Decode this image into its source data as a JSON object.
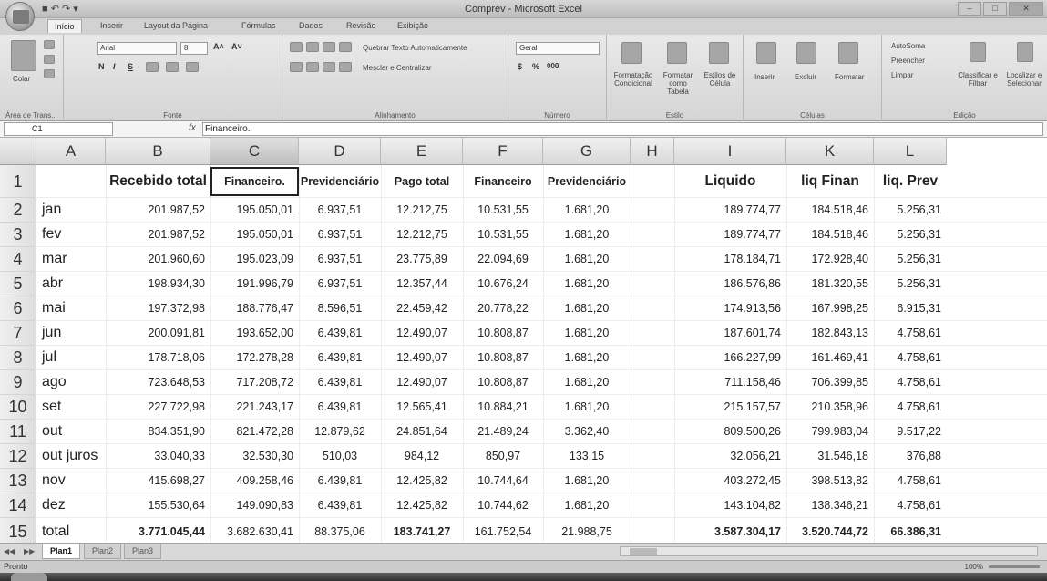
{
  "window": {
    "title": "Comprev - Microsoft Excel",
    "quick_access": "■ ↶ ↷ ▾",
    "minimize": "–",
    "maximize": "□",
    "close": "✕"
  },
  "ribbon_tabs": [
    "Início",
    "Inserir",
    "Layout da Página",
    "Fórmulas",
    "Dados",
    "Revisão",
    "Exibição"
  ],
  "ribbon": {
    "clipboard": {
      "paste": "Colar",
      "group": "Área de Trans..."
    },
    "font": {
      "name": "Arial",
      "size": "8",
      "grow": "A˄",
      "shrink": "A˅",
      "bold": "N",
      "italic": "I",
      "underline": "S",
      "group": "Fonte"
    },
    "alignment": {
      "wrap": "Quebrar Texto Automaticamente",
      "merge": "Mesclar e Centralizar",
      "group": "Alinhamento"
    },
    "number": {
      "format": "Geral",
      "currency": "$",
      "percent": "%",
      "thousands": "000",
      "group": "Número"
    },
    "styles": {
      "conditional": "Formatação Condicional",
      "as_table": "Formatar como Tabela",
      "cell_styles": "Estilos de Célula",
      "group": "Estilo"
    },
    "cells": {
      "insert": "Inserir",
      "delete": "Excluir",
      "format": "Formatar",
      "group": "Células"
    },
    "editing": {
      "autosum": "AutoSoma",
      "fill": "Preencher",
      "clear": "Limpar",
      "sort": "Classificar e Filtrar",
      "find": "Localizar e Selecionar",
      "group": "Edição"
    }
  },
  "formula_bar": {
    "name_box": "C1",
    "fx": "fx",
    "content": "Financeiro."
  },
  "columns": [
    "A",
    "B",
    "C",
    "D",
    "E",
    "F",
    "G",
    "H",
    "I",
    "K",
    "L"
  ],
  "headers": [
    "",
    "Recebido total",
    "Financeiro.",
    "Previdenciário",
    "Pago total",
    "Financeiro",
    "Previdenciário",
    "",
    "Liquido",
    "liq Finan",
    "liq. Prev"
  ],
  "rows": [
    [
      "jan",
      "201.987,52",
      "195.050,01",
      "6.937,51",
      "12.212,75",
      "10.531,55",
      "1.681,20",
      "",
      "189.774,77",
      "184.518,46",
      "5.256,31"
    ],
    [
      "fev",
      "201.987,52",
      "195.050,01",
      "6.937,51",
      "12.212,75",
      "10.531,55",
      "1.681,20",
      "",
      "189.774,77",
      "184.518,46",
      "5.256,31"
    ],
    [
      "mar",
      "201.960,60",
      "195.023,09",
      "6.937,51",
      "23.775,89",
      "22.094,69",
      "1.681,20",
      "",
      "178.184,71",
      "172.928,40",
      "5.256,31"
    ],
    [
      "abr",
      "198.934,30",
      "191.996,79",
      "6.937,51",
      "12.357,44",
      "10.676,24",
      "1.681,20",
      "",
      "186.576,86",
      "181.320,55",
      "5.256,31"
    ],
    [
      "mai",
      "197.372,98",
      "188.776,47",
      "8.596,51",
      "22.459,42",
      "20.778,22",
      "1.681,20",
      "",
      "174.913,56",
      "167.998,25",
      "6.915,31"
    ],
    [
      "jun",
      "200.091,81",
      "193.652,00",
      "6.439,81",
      "12.490,07",
      "10.808,87",
      "1.681,20",
      "",
      "187.601,74",
      "182.843,13",
      "4.758,61"
    ],
    [
      "jul",
      "178.718,06",
      "172.278,28",
      "6.439,81",
      "12.490,07",
      "10.808,87",
      "1.681,20",
      "",
      "166.227,99",
      "161.469,41",
      "4.758,61"
    ],
    [
      "ago",
      "723.648,53",
      "717.208,72",
      "6.439,81",
      "12.490,07",
      "10.808,87",
      "1.681,20",
      "",
      "711.158,46",
      "706.399,85",
      "4.758,61"
    ],
    [
      "set",
      "227.722,98",
      "221.243,17",
      "6.439,81",
      "12.565,41",
      "10.884,21",
      "1.681,20",
      "",
      "215.157,57",
      "210.358,96",
      "4.758,61"
    ],
    [
      "out",
      "834.351,90",
      "821.472,28",
      "12.879,62",
      "24.851,64",
      "21.489,24",
      "3.362,40",
      "",
      "809.500,26",
      "799.983,04",
      "9.517,22"
    ],
    [
      "out juros",
      "33.040,33",
      "32.530,30",
      "510,03",
      "984,12",
      "850,97",
      "133,15",
      "",
      "32.056,21",
      "31.546,18",
      "376,88"
    ],
    [
      "nov",
      "415.698,27",
      "409.258,46",
      "6.439,81",
      "12.425,82",
      "10.744,64",
      "1.681,20",
      "",
      "403.272,45",
      "398.513,82",
      "4.758,61"
    ],
    [
      "dez",
      "155.530,64",
      "149.090,83",
      "6.439,81",
      "12.425,82",
      "10.744,62",
      "1.681,20",
      "",
      "143.104,82",
      "138.346,21",
      "4.758,61"
    ],
    [
      "total",
      "3.771.045,44",
      "3.682.630,41",
      "88.375,06",
      "183.741,27",
      "161.752,54",
      "21.988,75",
      "",
      "3.587.304,17",
      "3.520.744,72",
      "66.386,31"
    ]
  ],
  "sheets": [
    "Plan1",
    "Plan2",
    "Plan3"
  ],
  "status": {
    "text": "Pronto",
    "zoom": "100%"
  }
}
